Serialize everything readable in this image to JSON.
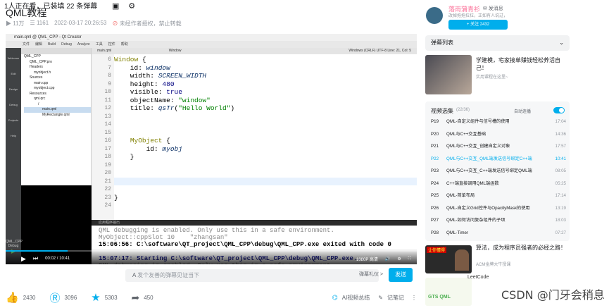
{
  "title": "QML教程",
  "meta": {
    "views": "11万",
    "danmaku": "1161",
    "date": "2022-03-17 20:26:53",
    "notice": "未经作者授权，禁止转载"
  },
  "qt": {
    "window_title": "main.qml @ QML_CPP - Qt Creator",
    "menu": [
      "文件",
      "编辑",
      "Build",
      "Debug",
      "Analyze",
      "工具",
      "控件",
      "帮助"
    ],
    "editor_tab": "main.qml",
    "breadcrumb": "Window",
    "encoding": "Windows (CRLF)  UTF-8  Line: 21, Col: 5",
    "left_modes": [
      "Welcome",
      "Edit",
      "Design",
      "Debug",
      "Projects",
      "Help"
    ],
    "project_tree": [
      "QML_CPP",
      "QML_CPP.pro",
      "Headers",
      "myobject.h",
      "Sources",
      "main.cpp",
      "myobject.cpp",
      "Resources",
      "qml.qrc",
      "/",
      "main.qml",
      "MyRectangle.qml"
    ],
    "kit": "QML_CPP",
    "kit_mode": "Debug"
  },
  "code_lines": [
    {
      "n": "6",
      "t": "Window {"
    },
    {
      "n": "7",
      "t": "    id: window"
    },
    {
      "n": "8",
      "t": "    width: SCREEN_WIDTH"
    },
    {
      "n": "9",
      "t": "    height: 480"
    },
    {
      "n": "10",
      "t": "    visible: true"
    },
    {
      "n": "11",
      "t": "    objectName: \"window\""
    },
    {
      "n": "12",
      "t": "    title: qsTr(\"Hello World\")"
    },
    {
      "n": "13",
      "t": ""
    },
    {
      "n": "14",
      "t": ""
    },
    {
      "n": "15",
      "t": ""
    },
    {
      "n": "16",
      "t": "    MyObject {"
    },
    {
      "n": "17",
      "t": "        id: myobj"
    },
    {
      "n": "18",
      "t": "    }"
    },
    {
      "n": "19",
      "t": ""
    },
    {
      "n": "20",
      "t": ""
    },
    {
      "n": "21",
      "t": ""
    },
    {
      "n": "22",
      "t": ""
    },
    {
      "n": "23",
      "t": "}"
    },
    {
      "n": "24",
      "t": ""
    }
  ],
  "output_tab": "应用程序输出",
  "output_lines": [
    {
      "c": "gray",
      "t": "QML debugging is enabled. Only use this in a safe environment."
    },
    {
      "c": "gray",
      "t": "MyObject::cppSlot 10    \"zhangsan\""
    },
    {
      "c": "bold",
      "t": "15:06:56: C:\\software\\QT_project\\QML_CPP\\debug\\QML_CPP.exe exited with code 0"
    },
    {
      "c": "",
      "t": ""
    },
    {
      "c": "blue",
      "t": "15:07:17: Starting C:\\software\\QT_project\\QML_CPP\\debug\\QML_CPP.exe..."
    },
    {
      "c": "gray",
      "t": "QML debugging is enabled. Only use this in a safe environment."
    },
    {
      "c": "blue",
      "t": "15:07:19: C:\\software\\QT_project\\QML_CPP\\debug\\QML_CPP.exe exited with code 0"
    }
  ],
  "player": {
    "time": "00:02 / 10:41",
    "quality": "1080P 高清",
    "badge": "关注",
    "bottom_tabs": [
      "1 问题",
      "2 Search Results",
      "3 应用程序输出",
      "4 编译输出",
      "5 QML Debugger Console",
      "6 概要信息",
      "8 Test Results"
    ]
  },
  "danmaku_bar": {
    "watching": "1人正在看，已装填 22 条弹幕",
    "placeholder": "发个友善的弹幕见证当下",
    "etiquette": "弹幕礼仪 >",
    "send": "发送"
  },
  "actions": {
    "like": "2430",
    "coin": "3096",
    "fav": "5303",
    "share": "450",
    "ai": "AI视频总结",
    "notes": "记笔记"
  },
  "up": {
    "name": "落雨蒲青衫",
    "msg": "发消息",
    "desc": "改掉拖拖拉拉，正如有人说过，",
    "charge": "充电",
    "follow": "+ 关注 2432"
  },
  "danmaku_list": "弹幕列表",
  "ad": {
    "title": "学建模，宅家接单赚钱轻松养活自己！",
    "sub": "实用课程在这里~"
  },
  "playlist": {
    "title": "视频选集",
    "count": "(22/36)",
    "auto": "自动连播",
    "items": [
      {
        "ep": "P19",
        "name": "QML-自定义组件与信号槽的使用",
        "dur": "17:04",
        "active": false
      },
      {
        "ep": "P20",
        "name": "QML与C++交互基础",
        "dur": "14:36",
        "active": false
      },
      {
        "ep": "P21",
        "name": "QML与C++交互_创建自定义对象",
        "dur": "17:57",
        "active": false
      },
      {
        "ep": "P22",
        "name": "QML与C++交互_QML端发送信号绑定C++端",
        "dur": "10:41",
        "active": true
      },
      {
        "ep": "P23",
        "name": "QML与C++交互_C++端发送信号绑定QML端",
        "dur": "08:05",
        "active": false
      },
      {
        "ep": "P24",
        "name": "C++端直接调用QML端函数",
        "dur": "05:25",
        "active": false
      },
      {
        "ep": "P25",
        "name": "QML-简单布局",
        "dur": "17:14",
        "active": false
      },
      {
        "ep": "P26",
        "name": "QML-自定义Grid控件与OpacityMask的使用",
        "dur": "13:19",
        "active": false
      },
      {
        "ep": "P27",
        "name": "QML-如何访问复杂组件的子项",
        "dur": "18:03",
        "active": false
      },
      {
        "ep": "P28",
        "name": "QML-Timer",
        "dur": "07:27",
        "active": false
      }
    ]
  },
  "rec1": {
    "title": "算法，成为程序员强者的必经之路！",
    "sub": "ACM金牌大牛授课",
    "img_text": "让你懂得"
  },
  "rec2": {
    "title": "LeetCode",
    "img_text": "GTS QML"
  },
  "watermark": "CSDN @门牙会稍息"
}
